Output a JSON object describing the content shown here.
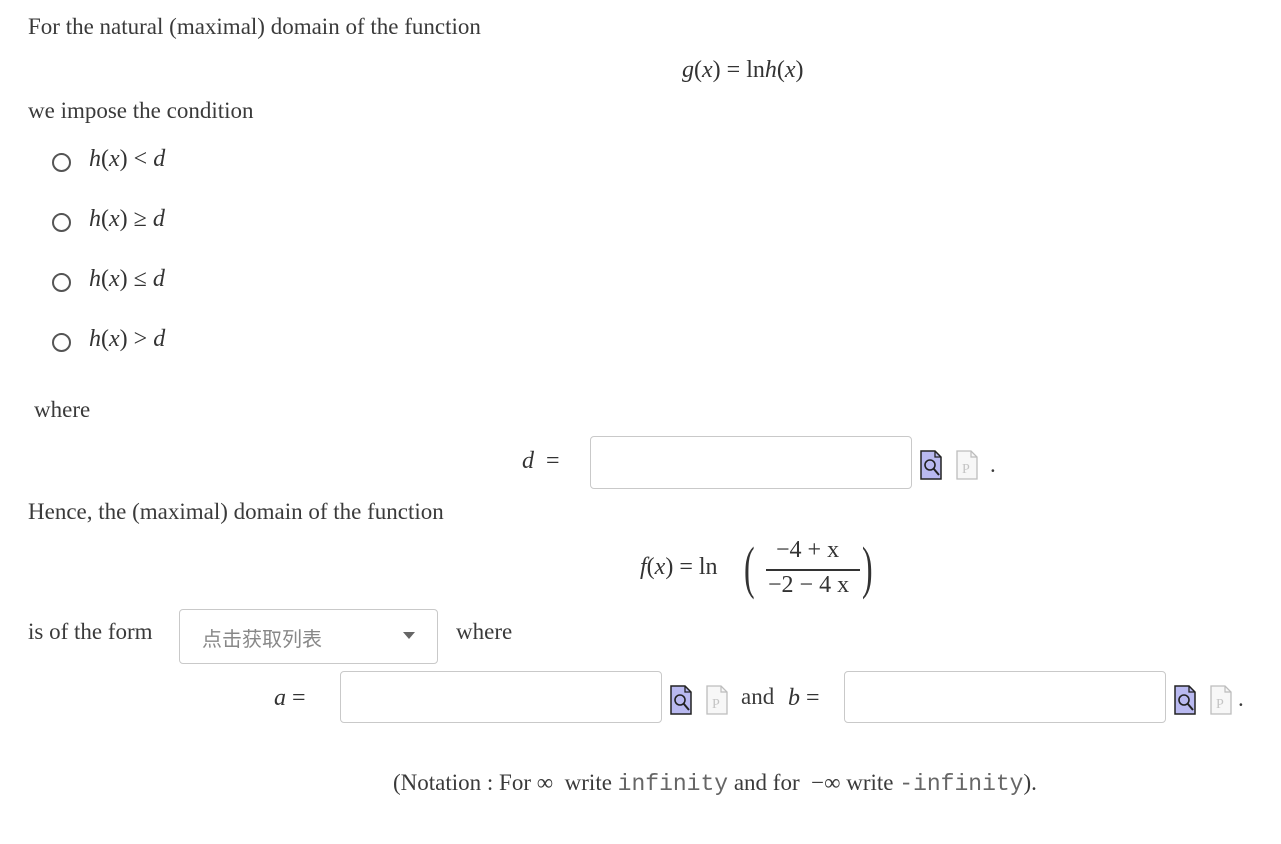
{
  "intro": "For the natural (maximal) domain of the function",
  "g_def": {
    "lhs": "g",
    "arg": "x",
    "eq": "=",
    "ln": "ln",
    "h": "h",
    "harg": "x"
  },
  "condition_text": "we impose the condition",
  "options": [
    {
      "h": "h",
      "x": "x",
      "rel": "<",
      "d": "d"
    },
    {
      "h": "h",
      "x": "x",
      "rel": "≥",
      "d": "d"
    },
    {
      "h": "h",
      "x": "x",
      "rel": "≤",
      "d": "d"
    },
    {
      "h": "h",
      "x": "x",
      "rel": ">",
      "d": "d"
    }
  ],
  "where1": "where",
  "d_eq": {
    "var": "d",
    "eq": "="
  },
  "period": ".",
  "hence_text": "Hence, the (maximal) domain of the function",
  "f_def": {
    "lhs": "f",
    "arg": "x",
    "eq": "=",
    "ln": "ln",
    "num": "−4 + x",
    "den": "−2 − 4 x"
  },
  "form_text": "is of the form",
  "select_placeholder": "点击获取列表",
  "where2": "where",
  "a_eq": {
    "var": "a",
    "eq": "="
  },
  "and_text": "and",
  "b_eq": {
    "var": "b",
    "eq": "="
  },
  "notation": {
    "open": "(Notation : For",
    "inf": "∞",
    "write1": "write",
    "code1": "infinity",
    "and_for": "and for",
    "neginf": "−∞",
    "write2": "write",
    "code2": "-infinity",
    "close": ")."
  },
  "icons": {
    "preview": "preview-icon",
    "formula": "formula-editor-icon"
  },
  "colors": {
    "text": "#3a3a3a",
    "border": "#c9c9c9",
    "icon_blue": "#b9b9f0"
  }
}
